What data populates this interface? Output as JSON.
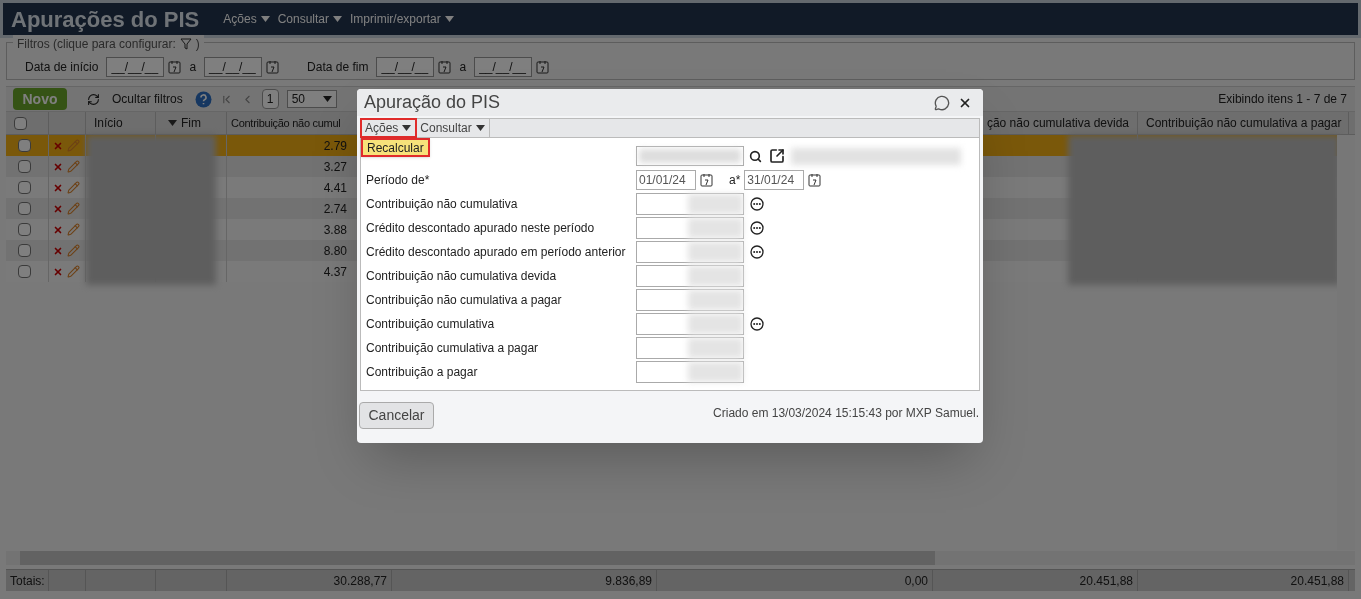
{
  "header": {
    "title": "Apurações do PIS",
    "menus": [
      "Ações",
      "Consultar",
      "Imprimir/exportar"
    ]
  },
  "filters": {
    "legend": "Filtros (clique para configurar:",
    "legend_end": ")",
    "fields": [
      {
        "label": "Data de início",
        "from": "__/__/__",
        "sep": "a",
        "to": "__/__/__"
      },
      {
        "label": "Data de fim",
        "from": "__/__/__",
        "sep": "a",
        "to": "__/__/__"
      }
    ]
  },
  "toolbar": {
    "new_button": "Novo",
    "hide_filters": "Ocultar filtros",
    "page": "1",
    "page_size": "50",
    "status": "Exibindo itens 1 - 7 de 7"
  },
  "table": {
    "columns": [
      "Início",
      "Fim",
      "Contribuição não cumul",
      "ção não cumulativa devida",
      "Contribuição não cumulativa a pagar"
    ],
    "rows": [
      {
        "selected": true,
        "column_5": "2.79"
      },
      {
        "selected": false,
        "column_5": "3.27"
      },
      {
        "selected": false,
        "column_5": "4.41"
      },
      {
        "selected": false,
        "column_5": "2.74"
      },
      {
        "selected": false,
        "column_5": "3.88"
      },
      {
        "selected": false,
        "column_5": "8.80"
      },
      {
        "selected": false,
        "column_5": "4.37"
      }
    ],
    "select_all_checked": false,
    "totals_label": "Totais:",
    "totals": [
      "30.288,77",
      "9.836,89",
      "0,00",
      "20.451,88",
      "20.451,88"
    ]
  },
  "dialog": {
    "title": "Apuração do PIS",
    "menus": [
      {
        "label": "Ações",
        "selected": true
      },
      {
        "label": "Consultar",
        "selected": false
      }
    ],
    "dropdown": [
      "Recalcular"
    ],
    "fields": [
      {
        "kind": "lookup"
      },
      {
        "kind": "period",
        "label": "Período de*",
        "from": "01/01/24",
        "sep": "a*",
        "to": "31/01/24"
      },
      {
        "kind": "amount",
        "label": "Contribuição não cumulativa",
        "details": true
      },
      {
        "kind": "amount",
        "label": "Crédito descontado apurado neste período",
        "details": true
      },
      {
        "kind": "amount",
        "label": "Crédito descontado apurado em período anterior",
        "details": true
      },
      {
        "kind": "amount",
        "label": "Contribuição não cumulativa devida",
        "details": false
      },
      {
        "kind": "amount",
        "label": "Contribuição não cumulativa a pagar",
        "details": false
      },
      {
        "kind": "amount",
        "label": "Contribuição cumulativa",
        "details": true
      },
      {
        "kind": "amount",
        "label": "Contribuição cumulativa a pagar",
        "details": false
      },
      {
        "kind": "amount",
        "label": "Contribuição a pagar",
        "details": false
      }
    ],
    "cancel": "Cancelar",
    "created": "Criado em 13/03/2024 15:15:43 por MXP Samuel."
  }
}
